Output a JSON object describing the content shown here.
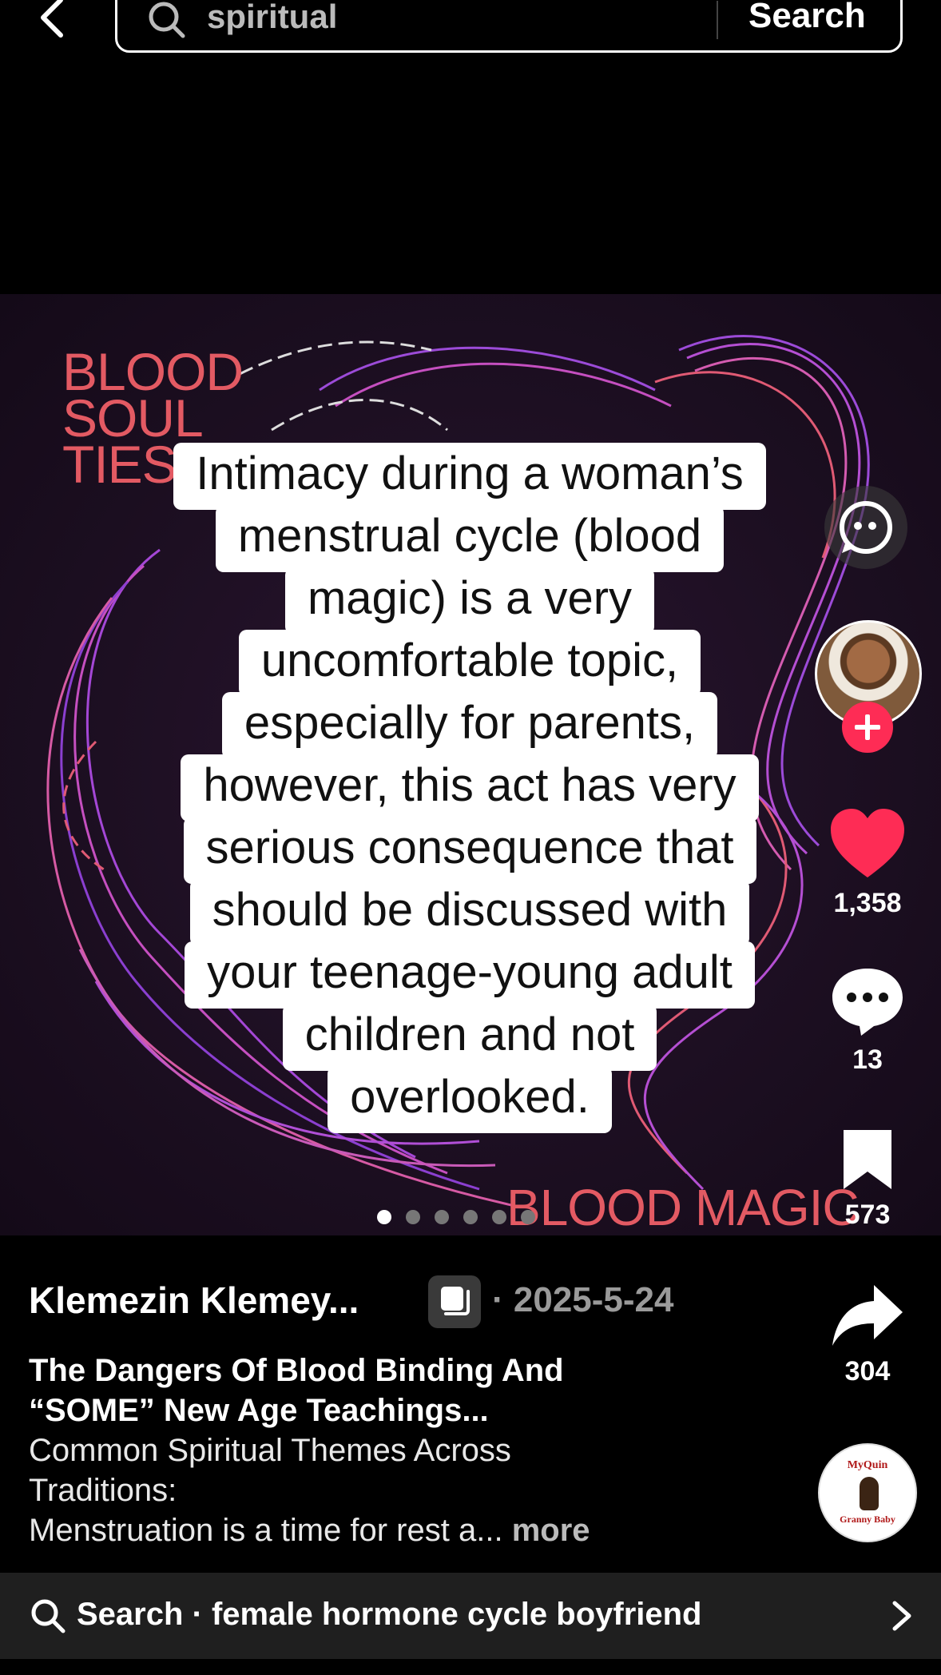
{
  "search": {
    "query": "spiritual",
    "button_label": "Search"
  },
  "post": {
    "background_title_lines": [
      "BLOOD",
      "SOUL",
      "TIES"
    ],
    "background_subtitle": "BLOOD MAGIC",
    "caption_lines": [
      "Intimacy during a woman’s",
      "menstrual cycle (blood",
      "magic) is a very",
      "uncomfortable topic,",
      "especially for parents,",
      "however, this act has very",
      "serious consequence that",
      "should be discussed with",
      "your teenage-young adult",
      "children and not",
      "overlooked."
    ],
    "carousel": {
      "total": 6,
      "active_index": 0
    }
  },
  "actions": {
    "likes": "1,358",
    "comments": "13",
    "saves": "573",
    "shares": "304"
  },
  "author": {
    "name": "Klemezin Klemey...",
    "date": "· 2025-5-24"
  },
  "caption": {
    "title_line1": "The Dangers Of Blood Binding And",
    "title_line2": "“SOME” New Age Teachings...",
    "desc_line1": "Common Spiritual Themes Across",
    "desc_line2": "Traditions:",
    "desc_line3": "Menstruation is a time for rest a...",
    "more_label": "more"
  },
  "music": {
    "top_text": "MyQuin",
    "bottom_text": "Granny Baby"
  },
  "suggestion": {
    "label": "Search · female hormone cycle boyfriend"
  },
  "colors": {
    "accent": "#fe2c55",
    "poster_red": "#e35a63",
    "background": "#000000"
  },
  "icons": [
    "back-icon",
    "search-icon",
    "ai-face-icon",
    "plus-icon",
    "heart-icon",
    "comment-icon",
    "bookmark-icon",
    "share-icon",
    "photo-mode-icon",
    "chevron-right-icon"
  ]
}
